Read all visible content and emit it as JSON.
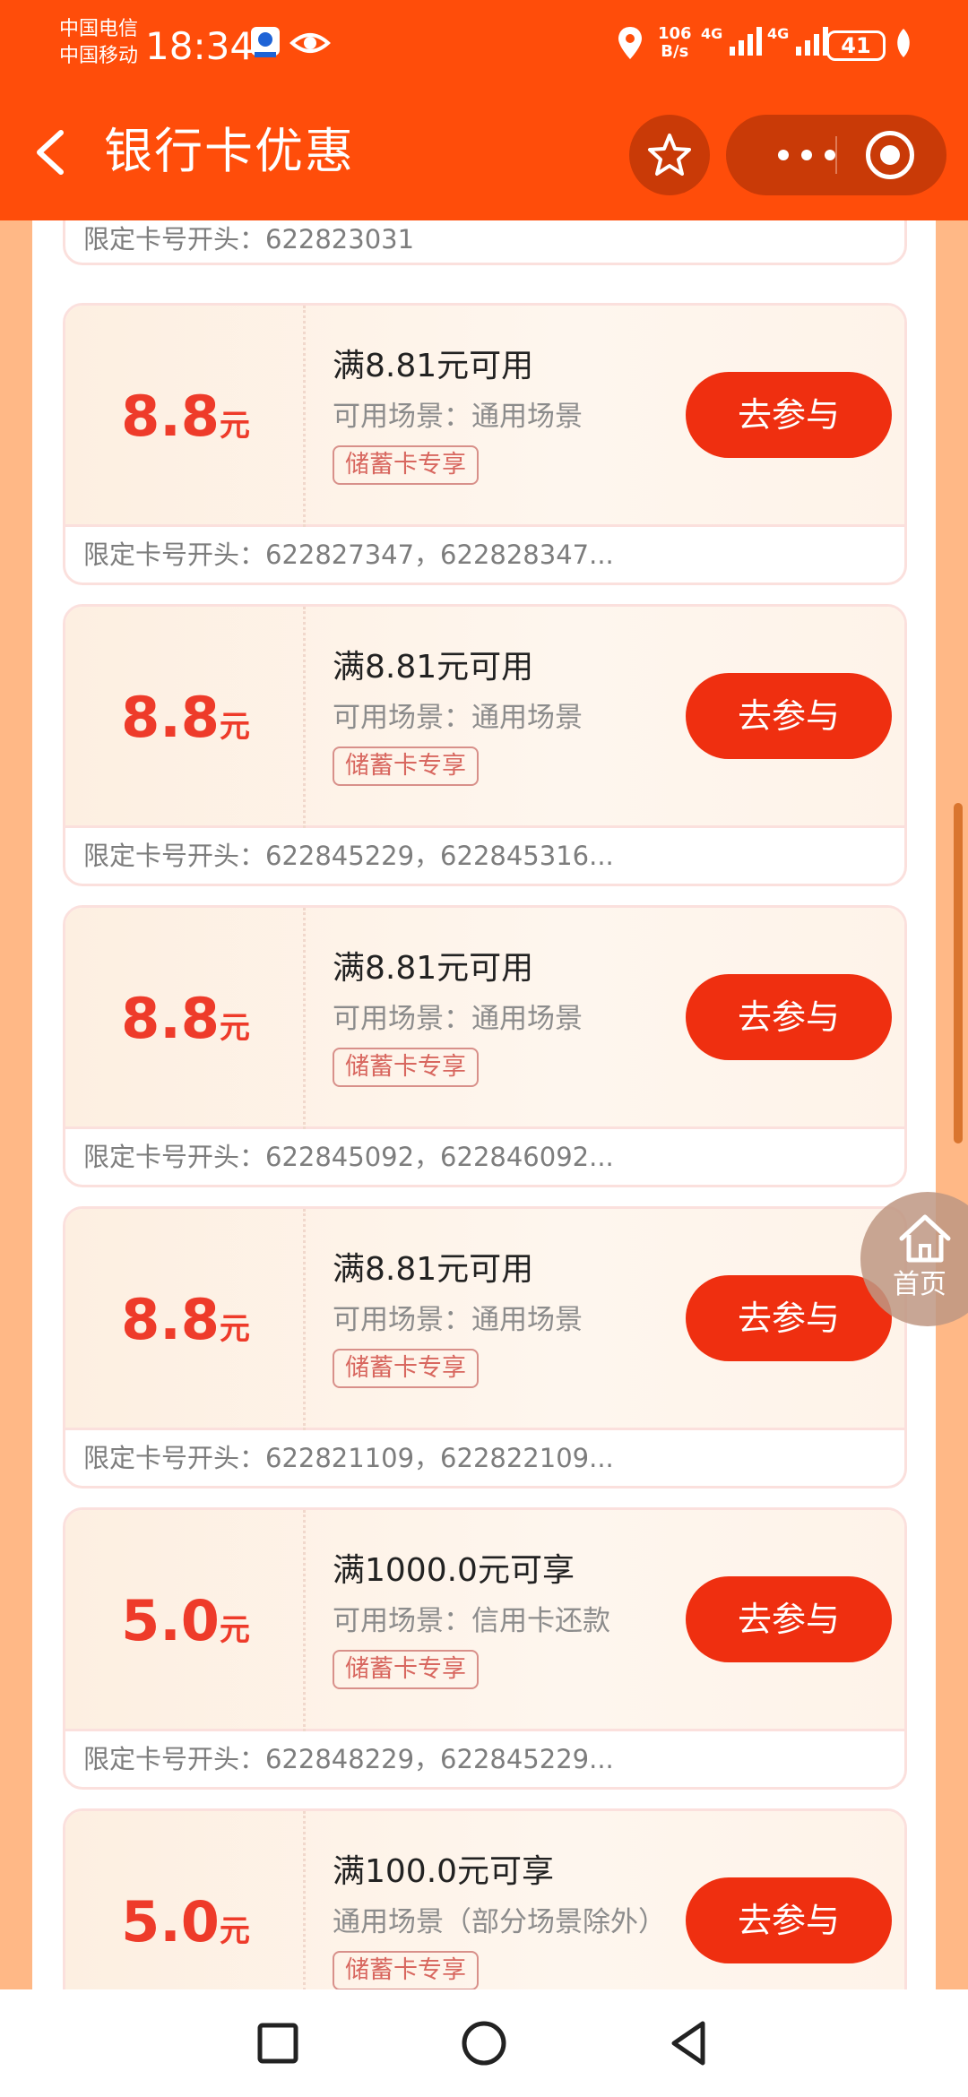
{
  "status": {
    "carrier1": "中国电信",
    "carrier2": "中国移动",
    "time": "18:34",
    "netspeed_value": "106",
    "netspeed_unit": "B/s",
    "sig1": "4G",
    "sig2": "4G",
    "battery": "41"
  },
  "header": {
    "title": "银行卡优惠"
  },
  "coupons": [
    {
      "prefix": "限定卡号开头：622823031"
    },
    {
      "amount": "8.8",
      "unit": "元",
      "condition": "满8.81元可用",
      "scene": "可用场景：通用场景",
      "tag": "储蓄卡专享",
      "button": "去参与",
      "prefix": "限定卡号开头：622827347，622828347..."
    },
    {
      "amount": "8.8",
      "unit": "元",
      "condition": "满8.81元可用",
      "scene": "可用场景：通用场景",
      "tag": "储蓄卡专享",
      "button": "去参与",
      "prefix": "限定卡号开头：622845229，622845316..."
    },
    {
      "amount": "8.8",
      "unit": "元",
      "condition": "满8.81元可用",
      "scene": "可用场景：通用场景",
      "tag": "储蓄卡专享",
      "button": "去参与",
      "prefix": "限定卡号开头：622845092，622846092..."
    },
    {
      "amount": "8.8",
      "unit": "元",
      "condition": "满8.81元可用",
      "scene": "可用场景：通用场景",
      "tag": "储蓄卡专享",
      "button": "去参与",
      "prefix": "限定卡号开头：622821109，622822109..."
    },
    {
      "amount": "5.0",
      "unit": "元",
      "condition": "满1000.0元可享",
      "scene": "可用场景：信用卡还款",
      "tag": "储蓄卡专享",
      "button": "去参与",
      "prefix": "限定卡号开头：622848229，622845229..."
    },
    {
      "amount": "5.0",
      "unit": "元",
      "condition": "满100.0元可享",
      "scene": "通用场景（部分场景除外）",
      "tag": "储蓄卡专享",
      "button": "去参与"
    }
  ],
  "float_home": {
    "label": "首页"
  },
  "colors": {
    "brand": "#ff4d0a",
    "accent": "#ef2f10",
    "amount": "#ee3b2a"
  }
}
